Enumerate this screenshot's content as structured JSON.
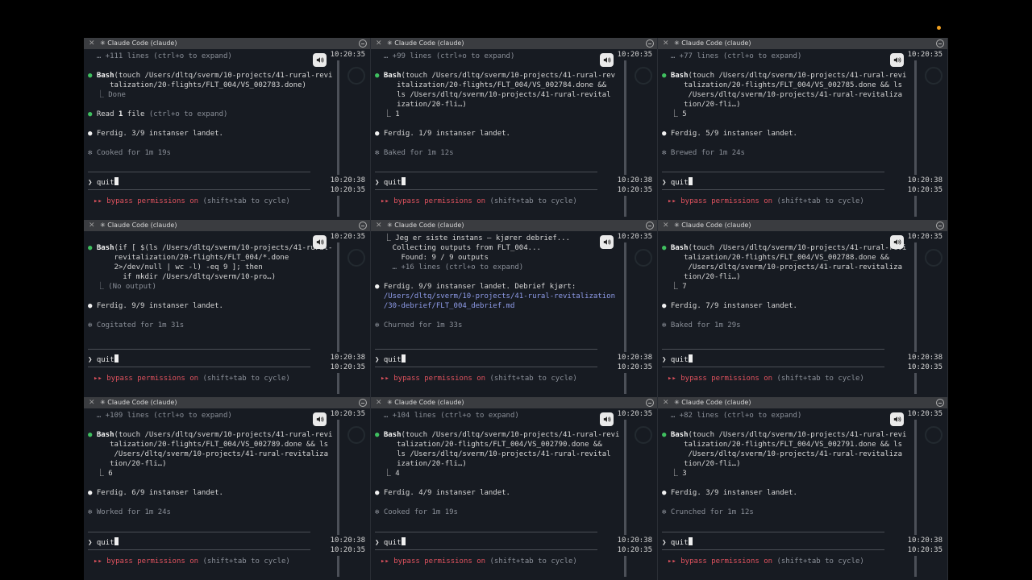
{
  "window_title": "Claude Code (claude)",
  "time_top": "10:20:35",
  "time_bottom_a": "10:20:38",
  "time_bottom_b": "10:20:35",
  "prompt_text": "quit",
  "bypass_icon": "▸▸",
  "bypass_label": "bypass permissions on",
  "bypass_hint": "(shift+tab to cycle)",
  "colors": {
    "accent_green": "#3fbf5f",
    "bypass_red": "#e0525e",
    "path_blue": "#8e9be8"
  },
  "icons": [
    "close-icon",
    "minimize-icon",
    "speaker-icon"
  ],
  "panes": [
    {
      "lines": [
        {
          "t": "dim",
          "text": "  … +111 lines (ctrl+o to expand)"
        },
        {
          "t": "blank"
        },
        {
          "t": "bash",
          "head": "Bash",
          "text": "(touch /Users/dltq/sverm/10-projects/41-rural-revi"
        },
        {
          "t": "plain",
          "text": "     talization/20-flights/FLT_004/VS_002783.done)"
        },
        {
          "t": "dim",
          "text": "  ⎿ Done"
        },
        {
          "t": "blank"
        },
        {
          "t": "read",
          "head": "Read ",
          "bold": "1",
          "text": " file",
          "hint": " (ctrl+o to expand)"
        },
        {
          "t": "blank"
        },
        {
          "t": "white",
          "text": "Ferdig. 3/9 instanser landet."
        },
        {
          "t": "blank"
        },
        {
          "t": "dim",
          "text": "✻ Cooked for 1m 19s"
        }
      ]
    },
    {
      "lines": [
        {
          "t": "dim",
          "text": "  … +99 lines (ctrl+o to expand)"
        },
        {
          "t": "blank"
        },
        {
          "t": "bash",
          "head": "Bash",
          "text": "(touch /Users/dltq/sverm/10-projects/41-rural-rev"
        },
        {
          "t": "plain",
          "text": "     italization/20-flights/FLT_004/VS_002784.done &&"
        },
        {
          "t": "plain",
          "text": "     ls /Users/dltq/sverm/10-projects/41-rural-revital"
        },
        {
          "t": "plain",
          "text": "     ization/20-fli…)"
        },
        {
          "t": "plain",
          "text": "  ⎿ 1"
        },
        {
          "t": "blank"
        },
        {
          "t": "white",
          "text": "Ferdig. 1/9 instanser landet."
        },
        {
          "t": "blank"
        },
        {
          "t": "dim",
          "text": "✻ Baked for 1m 12s"
        }
      ]
    },
    {
      "lines": [
        {
          "t": "dim",
          "text": "  … +77 lines (ctrl+o to expand)"
        },
        {
          "t": "blank"
        },
        {
          "t": "bash",
          "head": "Bash",
          "text": "(touch /Users/dltq/sverm/10-projects/41-rural-revi"
        },
        {
          "t": "plain",
          "text": "     talization/20-flights/FLT_004/VS_002785.done && ls"
        },
        {
          "t": "plain",
          "text": "      /Users/dltq/sverm/10-projects/41-rural-revitaliza"
        },
        {
          "t": "plain",
          "text": "     tion/20-fli…)"
        },
        {
          "t": "plain",
          "text": "  ⎿ 5"
        },
        {
          "t": "blank"
        },
        {
          "t": "white",
          "text": "Ferdig. 5/9 instanser landet."
        },
        {
          "t": "blank"
        },
        {
          "t": "dim",
          "text": "✻ Brewed for 1m 24s"
        }
      ]
    },
    {
      "lines": [
        {
          "t": "blank"
        },
        {
          "t": "bash",
          "head": "Bash",
          "text": "(if [ $(ls /Users/dltq/sverm/10-projects/41-rural-"
        },
        {
          "t": "plain",
          "text": "      revitalization/20-flights/FLT_004/*.done"
        },
        {
          "t": "plain",
          "text": "      2>/dev/null | wc -l) -eq 9 ]; then"
        },
        {
          "t": "plain",
          "text": "        if mkdir /Users/dltq/sverm/10-pro…)"
        },
        {
          "t": "dim",
          "text": "  ⎿ (No output)"
        },
        {
          "t": "blank"
        },
        {
          "t": "white",
          "text": "Ferdig. 9/9 instanser landet."
        },
        {
          "t": "blank"
        },
        {
          "t": "dim",
          "text": "✻ Cogitated for 1m 31s"
        }
      ]
    },
    {
      "lines": [
        {
          "t": "plain",
          "text": "  ⎿ Jeg er siste instans – kjører debrief..."
        },
        {
          "t": "plain",
          "text": "    Collecting outputs from FLT_004..."
        },
        {
          "t": "plain",
          "text": "      Found: 9 / 9 outputs"
        },
        {
          "t": "dim",
          "text": "    … +16 lines (ctrl+o to expand)"
        },
        {
          "t": "blank"
        },
        {
          "t": "white",
          "text": "Ferdig. 9/9 instanser landet. Debrief kjørt:"
        },
        {
          "t": "link",
          "text": "  /Users/dltq/sverm/10-projects/41-rural-revitalization"
        },
        {
          "t": "link",
          "text": "  /30-debrief/FLT_004_debrief.md"
        },
        {
          "t": "blank"
        },
        {
          "t": "dim",
          "text": "✻ Churned for 1m 33s"
        }
      ]
    },
    {
      "lines": [
        {
          "t": "blank"
        },
        {
          "t": "bash",
          "head": "Bash",
          "text": "(touch /Users/dltq/sverm/10-projects/41-rural-revi"
        },
        {
          "t": "plain",
          "text": "     talization/20-flights/FLT_004/VS_002788.done &&"
        },
        {
          "t": "plain",
          "text": "      /Users/dltq/sverm/10-projects/41-rural-revitaliza"
        },
        {
          "t": "plain",
          "text": "     tion/20-fli…)"
        },
        {
          "t": "plain",
          "text": "  ⎿ 7"
        },
        {
          "t": "blank"
        },
        {
          "t": "white",
          "text": "Ferdig. 7/9 instanser landet."
        },
        {
          "t": "blank"
        },
        {
          "t": "dim",
          "text": "✻ Baked for 1m 29s"
        }
      ]
    },
    {
      "lines": [
        {
          "t": "dim",
          "text": "  … +109 lines (ctrl+o to expand)"
        },
        {
          "t": "blank"
        },
        {
          "t": "bash",
          "head": "Bash",
          "text": "(touch /Users/dltq/sverm/10-projects/41-rural-revi"
        },
        {
          "t": "plain",
          "text": "     talization/20-flights/FLT_004/VS_002789.done && ls"
        },
        {
          "t": "plain",
          "text": "      /Users/dltq/sverm/10-projects/41-rural-revitaliza"
        },
        {
          "t": "plain",
          "text": "     tion/20-fli…)"
        },
        {
          "t": "plain",
          "text": "  ⎿ 6"
        },
        {
          "t": "blank"
        },
        {
          "t": "white",
          "text": "Ferdig. 6/9 instanser landet."
        },
        {
          "t": "blank"
        },
        {
          "t": "dim",
          "text": "✻ Worked for 1m 24s"
        }
      ]
    },
    {
      "lines": [
        {
          "t": "dim",
          "text": "  … +104 lines (ctrl+o to expand)"
        },
        {
          "t": "blank"
        },
        {
          "t": "bash",
          "head": "Bash",
          "text": "(touch /Users/dltq/sverm/10-projects/41-rural-revi"
        },
        {
          "t": "plain",
          "text": "     talization/20-flights/FLT_004/VS_002790.done &&"
        },
        {
          "t": "plain",
          "text": "     ls /Users/dltq/sverm/10-projects/41-rural-revital"
        },
        {
          "t": "plain",
          "text": "     ization/20-fli…)"
        },
        {
          "t": "plain",
          "text": "  ⎿ 4"
        },
        {
          "t": "blank"
        },
        {
          "t": "white",
          "text": "Ferdig. 4/9 instanser landet."
        },
        {
          "t": "blank"
        },
        {
          "t": "dim",
          "text": "✻ Cooked for 1m 19s"
        }
      ]
    },
    {
      "lines": [
        {
          "t": "dim",
          "text": "  … +82 lines (ctrl+o to expand)"
        },
        {
          "t": "blank"
        },
        {
          "t": "bash",
          "head": "Bash",
          "text": "(touch /Users/dltq/sverm/10-projects/41-rural-revi"
        },
        {
          "t": "plain",
          "text": "     talization/20-flights/FLT_004/VS_002791.done && ls"
        },
        {
          "t": "plain",
          "text": "      /Users/dltq/sverm/10-projects/41-rural-revitaliza"
        },
        {
          "t": "plain",
          "text": "     tion/20-fli…)"
        },
        {
          "t": "plain",
          "text": "  ⎿ 3"
        },
        {
          "t": "blank"
        },
        {
          "t": "white",
          "text": "Ferdig. 3/9 instanser landet."
        },
        {
          "t": "blank"
        },
        {
          "t": "dim",
          "text": "✻ Crunched for 1m 12s"
        }
      ]
    }
  ]
}
